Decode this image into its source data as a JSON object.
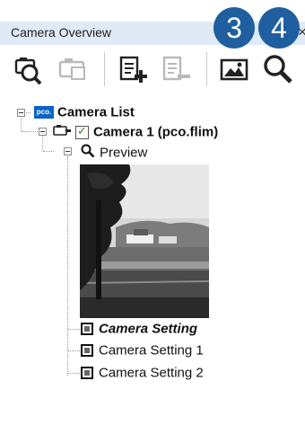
{
  "panel": {
    "title": "Camera Overview",
    "close_glyph": "×"
  },
  "toolbar": {
    "buttons": [
      {
        "name": "search-camera-button",
        "icon": "camera-search-icon"
      },
      {
        "name": "camera-disconnect-button",
        "icon": "camera-icon"
      },
      {
        "name": "add-setting-button",
        "icon": "document-add-icon"
      },
      {
        "name": "remove-setting-button",
        "icon": "document-remove-icon"
      },
      {
        "name": "image-preview-button",
        "icon": "image-icon"
      },
      {
        "name": "zoom-button",
        "icon": "magnifier-icon"
      }
    ],
    "badges": [
      "3",
      "4"
    ]
  },
  "tree": {
    "root": {
      "label": "Camera List",
      "logo_text": "pco."
    },
    "camera": {
      "label": "Camera 1 (pco.flim)",
      "checked": true
    },
    "preview": {
      "label": "Preview"
    },
    "settings": [
      {
        "label": "Camera Setting",
        "active": true
      },
      {
        "label": "Camera Setting 1",
        "active": false
      },
      {
        "label": "Camera Setting 2",
        "active": false
      }
    ]
  },
  "colors": {
    "header_bg": "#dfeaf6",
    "badge_bg": "#1f5f9f",
    "checkbox_green": "#2e8b2e",
    "pco_blue": "#0b63c6"
  }
}
